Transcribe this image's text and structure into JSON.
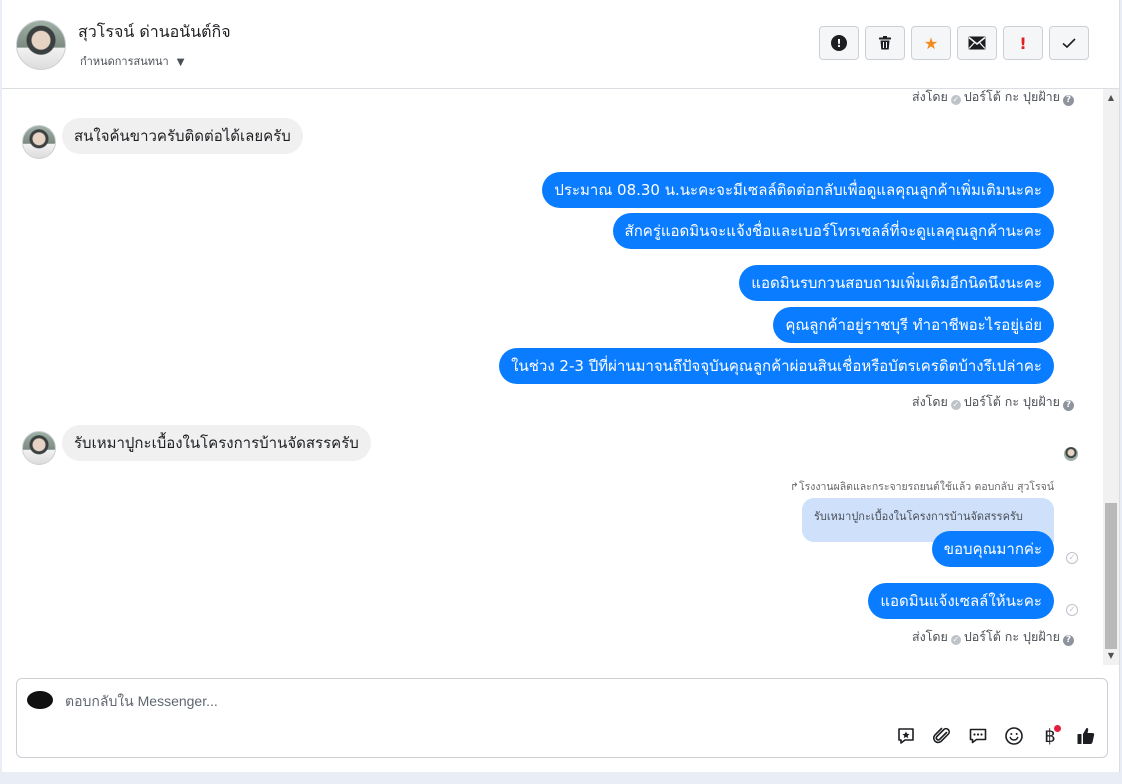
{
  "header": {
    "contact_name": "สุวโรจน์ ด่านอนันต์กิจ",
    "assign_label": "กำหนดการสนทนา",
    "action_icons": [
      "alert-circle-icon",
      "trash-icon",
      "star-icon",
      "envelope-icon",
      "exclamation-icon",
      "check-icon"
    ]
  },
  "thread": {
    "meta_sent_by": "ส่งโดย",
    "meta_author": "ปอร์โต้ กะ ปุยฝ้าย",
    "incoming_1": "สนใจค้นขาวครับติดต่อได้เลยครับ",
    "outgoing_group_1": [
      "ประมาณ 08.30 น.นะคะจะมีเซลล์ติดต่อกลับเพื่อดูแลคุณลูกค้าเพิ่มเติมนะคะ",
      "สักครู่แอดมินจะแจ้งชื่อและเบอร์โทรเซลล์ที่จะดูแลคุณลูกค้านะคะ"
    ],
    "outgoing_group_2": [
      "แอดมินรบกวนสอบถามเพิ่มเติมอีกนิดนึงนะคะ",
      "คุณลูกค้าอยู่ราชบุรี ทำอาชีพอะไรอยู่เอ่ย",
      "ในช่วง 2-3 ปีที่ผ่านมาจนถึปัจจุบันคุณลูกค้าผ่อนสินเชื่อหรือบัตรเครดิตบ้างรึเปล่าคะ"
    ],
    "incoming_2": "รับเหมาปูกะเบื้องในโครงการบ้านจัดสรรครับ",
    "reply_context": "โรงงานผลิตและกระจายรถยนต์ใช้แล้ว ตอบกลับ สุวโรจน์",
    "quoted_text": "รับเหมาปูกะเบื้องในโครงการบ้านจัดสรรครับ",
    "outgoing_reply": "ขอบคุณมากค่ะ",
    "outgoing_last": "แอดมินแจ้งเซลล์ให้นะคะ"
  },
  "composer": {
    "placeholder": "ตอบกลับใน Messenger...",
    "page_logo_text": "",
    "currency_symbol": "฿"
  },
  "colors": {
    "outgoing_bubble": "#0a7cff",
    "incoming_bubble": "#f0f0f0",
    "star": "#f28a1c",
    "alert": "#e02020"
  }
}
